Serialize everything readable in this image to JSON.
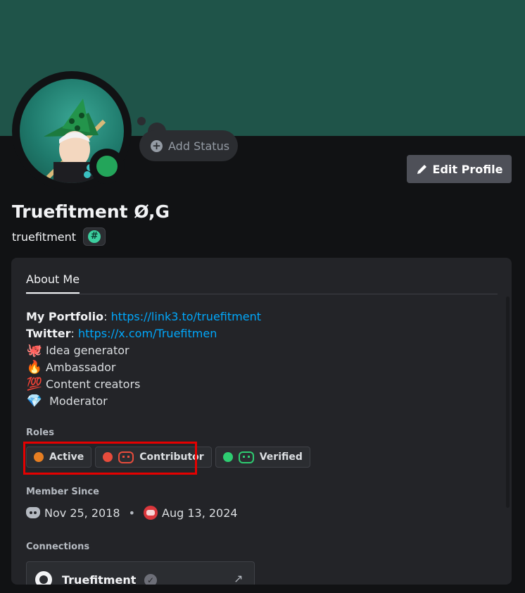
{
  "profile": {
    "display_name": "Truefitment Ø,G",
    "username": "truefitment",
    "tag_symbol": "#",
    "status_color": "#23a55a",
    "banner_color": "#1f5449"
  },
  "actions": {
    "add_status": "Add Status",
    "edit_profile": "Edit Profile"
  },
  "tabs": {
    "about": "About Me"
  },
  "bio": {
    "portfolio_label": "My Portfolio",
    "portfolio_url": "https://link3.to/truefitment",
    "twitter_label": "Twitter",
    "twitter_url": "https://x.com/Truefitmen",
    "lines": [
      {
        "emoji": "🐙",
        "text": "Idea generator"
      },
      {
        "emoji": "🔥",
        "text": "Ambassador"
      },
      {
        "emoji": "💯",
        "text": "Content creators"
      },
      {
        "emoji": "💎",
        "text": " Moderator"
      }
    ]
  },
  "roles": {
    "heading": "Roles",
    "items": [
      {
        "label": "Active",
        "color": "#e67e22",
        "icon": "none"
      },
      {
        "label": "Contributor",
        "color": "#e74c3c",
        "icon": "bot-icon"
      },
      {
        "label": "Verified",
        "color": "#2ecc71",
        "icon": "bot-icon"
      }
    ]
  },
  "member_since": {
    "heading": "Member Since",
    "discord_date": "Nov 25, 2018",
    "server_date": "Aug 13, 2024"
  },
  "connections": {
    "heading": "Connections",
    "items": [
      {
        "name": "Truefitment",
        "service": "github-icon"
      }
    ]
  }
}
